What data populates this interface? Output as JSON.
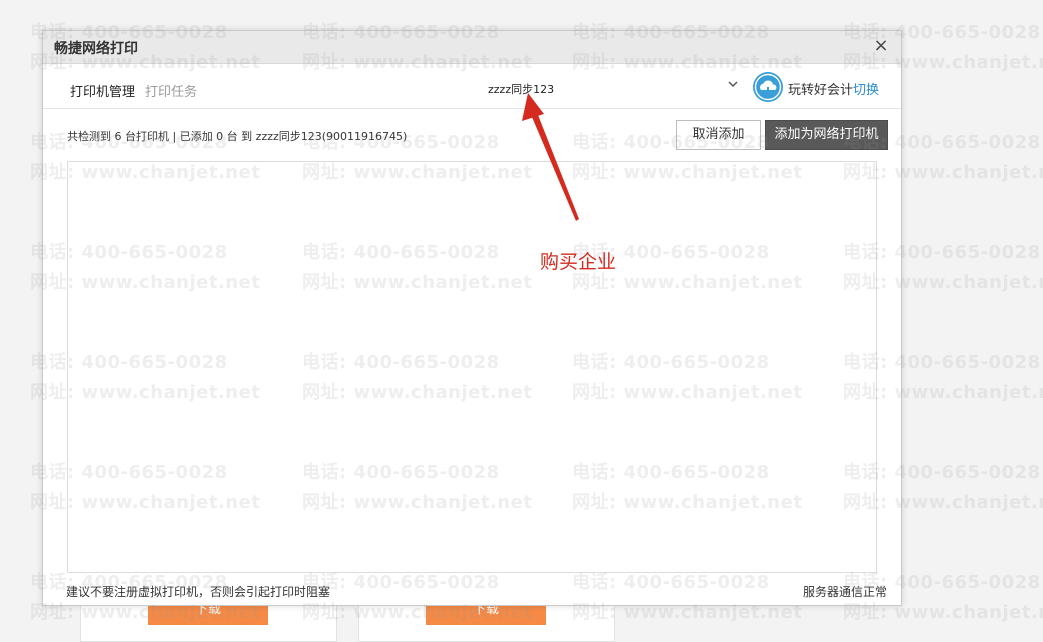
{
  "dialog": {
    "title": "畅捷网络打印",
    "close_glyph": "×",
    "tabs": [
      {
        "label": "打印机管理",
        "active": true
      },
      {
        "label": "打印任务",
        "active": false
      }
    ],
    "company": "zzzz同步123",
    "user": {
      "name": "玩转好会计",
      "switch_label": "切换"
    },
    "status_text": "共检测到 6 台打印机 | 已添加 0 台 到 zzzz同步123(90011916745)",
    "buttons": {
      "cancel": "取消添加",
      "add": "添加为网络打印机"
    },
    "footer": {
      "hint": "建议不要注册虚拟打印机，否则会引起打印时阻塞",
      "status": "服务器通信正常"
    }
  },
  "annotation": {
    "text": "购买企业",
    "color": "#d42a1f"
  },
  "background_page": {
    "download_label": "下载"
  },
  "watermark": {
    "phone": "电话: 400-665-0028",
    "site": "网址: www.chanjet.net"
  },
  "colors": {
    "accent_link": "#2a8bd0",
    "primary_button": "#595959",
    "download_button": "#f58a46"
  }
}
